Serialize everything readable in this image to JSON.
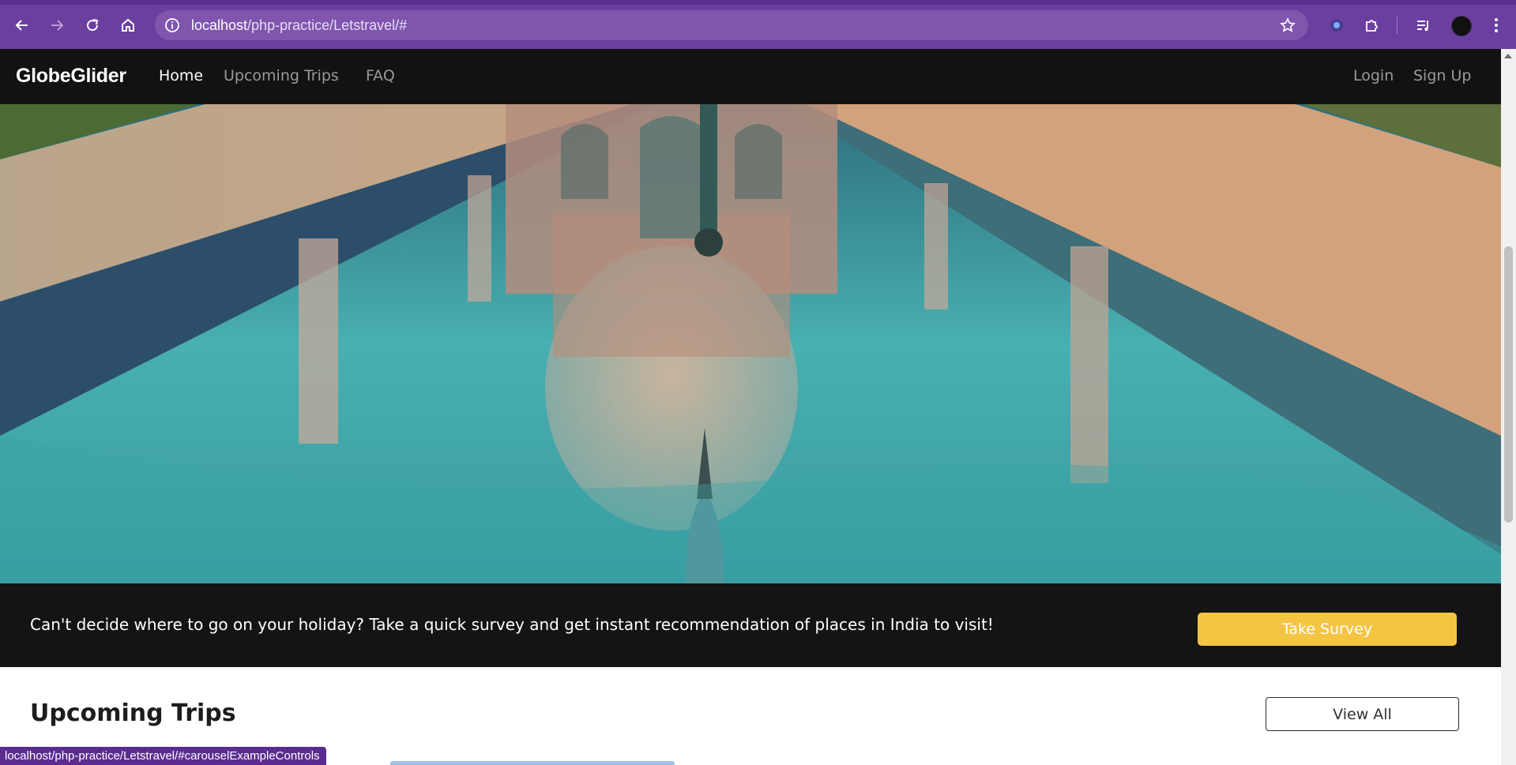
{
  "browser": {
    "url_host": "localhost",
    "url_path": "/php-practice/Letstravel/#",
    "status_url": "localhost/php-practice/Letstravel/#carouselExampleControls",
    "icons": [
      "back-icon",
      "forward-icon",
      "reload-icon",
      "home-icon",
      "site-info-icon",
      "bookmark-star-icon",
      "extension-icon",
      "puzzle-icon",
      "media-icon",
      "profile-avatar",
      "menu-icon"
    ]
  },
  "site": {
    "brand": "GlobeGlider",
    "nav": {
      "home": "Home",
      "upcoming": "Upcoming Trips",
      "faq": "FAQ",
      "login": "Login",
      "signup": "Sign Up"
    },
    "survey": {
      "text": "Can't decide where to go on your holiday? Take a quick survey and get instant recommendation of places in India to visit!",
      "button": "Take Survey"
    },
    "trips": {
      "title": "Upcoming Trips",
      "view_all": "View All"
    }
  },
  "colors": {
    "chrome": "#6b3fa0",
    "navbar": "#121212",
    "accent_button": "#f4c542"
  }
}
